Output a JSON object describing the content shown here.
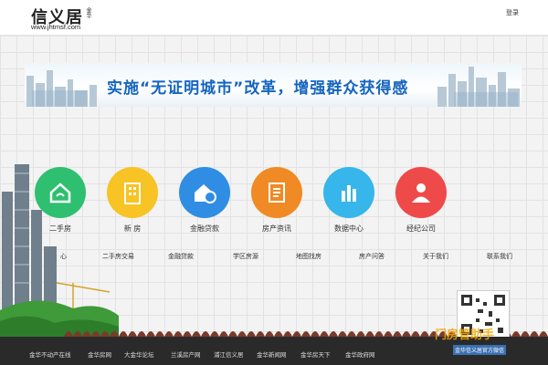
{
  "header": {
    "logo_main": "信义居",
    "logo_region": "金华",
    "logo_domain": "www.jhtmsf.com",
    "login_label": "登录"
  },
  "banner": {
    "slogan": "实施“无证明城市”改革，增强群众获得感"
  },
  "tiles": [
    {
      "label": "二手房",
      "color": "#2fbf71",
      "icon": "house-icon"
    },
    {
      "label": "新 房",
      "color": "#f7c325",
      "icon": "building-icon"
    },
    {
      "label": "金融贷款",
      "color": "#2f8de4",
      "icon": "house-money-icon"
    },
    {
      "label": "房产资讯",
      "color": "#f08a24",
      "icon": "document-icon"
    },
    {
      "label": "数据中心",
      "color": "#36b6ea",
      "icon": "bar-chart-icon"
    },
    {
      "label": "经纪公司",
      "color": "#ee4a4a",
      "icon": "agent-icon"
    }
  ],
  "nav": [
    "心",
    "二手房交易",
    "金融贷款",
    "学区房源",
    "地图找房",
    "房产问答",
    "关于我们",
    "联系我们"
  ],
  "footer": {
    "links": [
      "金华不动产在线",
      "金华房网",
      "大金华论坛",
      "兰溪房产网",
      "浦江信义居",
      "金华新闻网",
      "金华房天下",
      "金华政府网"
    ],
    "qr_caption": "金华信义居官方微信",
    "watermark": "门房管助手"
  }
}
